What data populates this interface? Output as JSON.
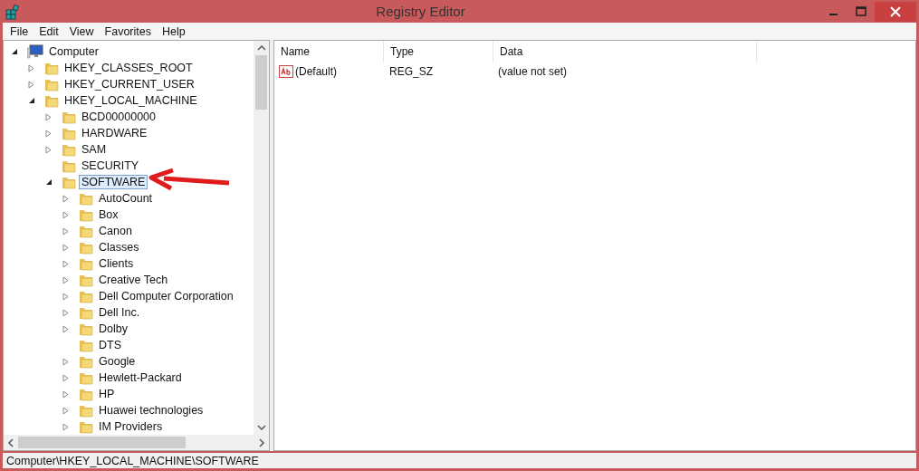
{
  "window": {
    "title": "Registry Editor"
  },
  "menu": [
    "File",
    "Edit",
    "View",
    "Favorites",
    "Help"
  ],
  "tree": [
    {
      "label": "Computer",
      "kind": "computer",
      "expanded": true,
      "selected": false,
      "children": [
        {
          "label": "HKEY_CLASSES_ROOT",
          "kind": "folder",
          "expanded": false,
          "selected": false
        },
        {
          "label": "HKEY_CURRENT_USER",
          "kind": "folder",
          "expanded": false,
          "selected": false
        },
        {
          "label": "HKEY_LOCAL_MACHINE",
          "kind": "folder",
          "expanded": true,
          "selected": false,
          "children": [
            {
              "label": "BCD00000000",
              "kind": "folder",
              "expanded": false,
              "selected": false
            },
            {
              "label": "HARDWARE",
              "kind": "folder",
              "expanded": false,
              "selected": false
            },
            {
              "label": "SAM",
              "kind": "folder",
              "expanded": false,
              "selected": false
            },
            {
              "label": "SECURITY",
              "kind": "folder",
              "selected": false
            },
            {
              "label": "SOFTWARE",
              "kind": "folder",
              "expanded": true,
              "selected": true,
              "children": [
                {
                  "label": "AutoCount",
                  "kind": "folder",
                  "expanded": false,
                  "selected": false
                },
                {
                  "label": "Box",
                  "kind": "folder",
                  "expanded": false,
                  "selected": false
                },
                {
                  "label": "Canon",
                  "kind": "folder",
                  "expanded": false,
                  "selected": false
                },
                {
                  "label": "Classes",
                  "kind": "folder",
                  "expanded": false,
                  "selected": false
                },
                {
                  "label": "Clients",
                  "kind": "folder",
                  "expanded": false,
                  "selected": false
                },
                {
                  "label": "Creative Tech",
                  "kind": "folder",
                  "expanded": false,
                  "selected": false
                },
                {
                  "label": "Dell Computer Corporation",
                  "kind": "folder",
                  "expanded": false,
                  "selected": false
                },
                {
                  "label": "Dell Inc.",
                  "kind": "folder",
                  "expanded": false,
                  "selected": false
                },
                {
                  "label": "Dolby",
                  "kind": "folder",
                  "expanded": false,
                  "selected": false
                },
                {
                  "label": "DTS",
                  "kind": "folder",
                  "selected": false
                },
                {
                  "label": "Google",
                  "kind": "folder",
                  "expanded": false,
                  "selected": false
                },
                {
                  "label": "Hewlett-Packard",
                  "kind": "folder",
                  "expanded": false,
                  "selected": false
                },
                {
                  "label": "HP",
                  "kind": "folder",
                  "expanded": false,
                  "selected": false
                },
                {
                  "label": "Huawei technologies",
                  "kind": "folder",
                  "expanded": false,
                  "selected": false
                },
                {
                  "label": "IM Providers",
                  "kind": "folder",
                  "expanded": false,
                  "selected": false
                }
              ]
            }
          ]
        }
      ]
    }
  ],
  "values": {
    "columns": [
      "Name",
      "Type",
      "Data"
    ],
    "rows": [
      {
        "name": "(Default)",
        "type": "REG_SZ",
        "data": "(value not set)"
      }
    ]
  },
  "status_bar": "Computer\\HKEY_LOCAL_MACHINE\\SOFTWARE"
}
